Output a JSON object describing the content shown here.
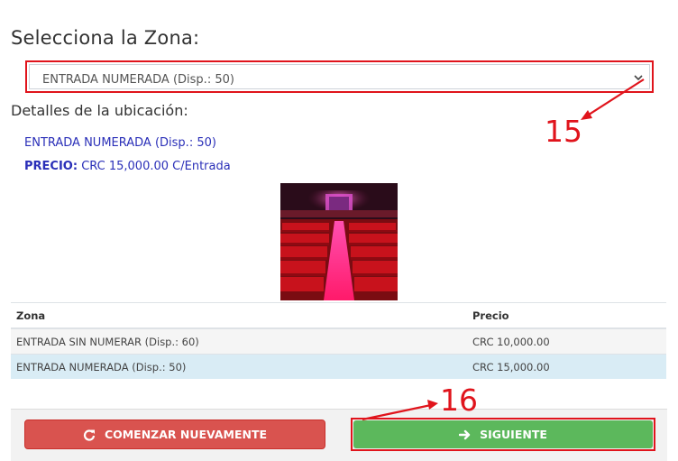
{
  "page": {
    "title": "Selecciona la Zona:",
    "details_title": "Detalles de la ubicación:"
  },
  "zone_select": {
    "selected_value": "ENTRADA NUMERADA (Disp.: 50)"
  },
  "details": {
    "zone_name": "ENTRADA NUMERADA (Disp.: 50)",
    "price_label": "PRECIO:",
    "price_value": "CRC 15,000.00 C/Entrada"
  },
  "table": {
    "headers": [
      "Zona",
      "Precio"
    ],
    "rows": [
      {
        "zona": "ENTRADA SIN NUMERAR (Disp.: 60)",
        "precio": "CRC 10,000.00"
      },
      {
        "zona": "ENTRADA NUMERADA (Disp.: 50)",
        "precio": "CRC 15,000.00"
      }
    ]
  },
  "buttons": {
    "restart_label": "COMENZAR NUEVAMENTE",
    "next_label": "SIGUIENTE"
  },
  "annotations": {
    "step_a": "15",
    "step_b": "16",
    "color": "#e0141c"
  },
  "colors": {
    "link_blue": "#2a2fb8",
    "danger": "#d9534f",
    "success": "#5cb85c",
    "selected_row": "#d9ecf5"
  }
}
